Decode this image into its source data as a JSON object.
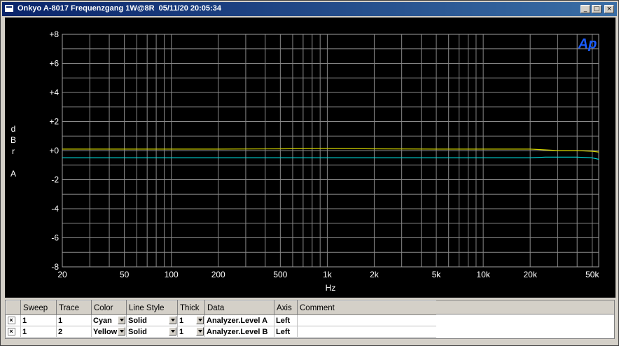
{
  "window": {
    "title": "Onkyo A-8017 Frequenzgang 1W@8R  05/11/20 20:05:34",
    "min_label": "_",
    "max_label": "□",
    "close_label": "×"
  },
  "chart_data": {
    "type": "line",
    "xlabel": "Hz",
    "ylabel": "dBr A",
    "x_scale": "log",
    "xlim": [
      20,
      55000
    ],
    "ylim": [
      -8,
      8
    ],
    "grid": true,
    "y_ticks": [
      "+8",
      "+6",
      "+4",
      "+2",
      "+0",
      "-2",
      "-4",
      "-6",
      "-8"
    ],
    "x_ticks": [
      "20",
      "50",
      "100",
      "200",
      "500",
      "1k",
      "2k",
      "5k",
      "10k",
      "20k",
      "50k"
    ],
    "logo": "Ap",
    "series": [
      {
        "color": "#00d8d8",
        "x": [
          20,
          50,
          100,
          200,
          500,
          1000,
          2000,
          5000,
          10000,
          20000,
          25000,
          30000,
          40000,
          50000,
          55000
        ],
        "y": [
          -0.5,
          -0.5,
          -0.5,
          -0.5,
          -0.5,
          -0.5,
          -0.5,
          -0.5,
          -0.5,
          -0.5,
          -0.45,
          -0.45,
          -0.45,
          -0.5,
          -0.6
        ]
      },
      {
        "color": "#d8d800",
        "x": [
          20,
          50,
          100,
          200,
          500,
          1000,
          2000,
          5000,
          10000,
          20000,
          25000,
          30000,
          40000,
          50000,
          55000
        ],
        "y": [
          0.1,
          0.1,
          0.1,
          0.1,
          0.12,
          0.15,
          0.12,
          0.1,
          0.1,
          0.1,
          0.05,
          0.0,
          0.0,
          -0.05,
          -0.1
        ]
      }
    ]
  },
  "table": {
    "headers": [
      "",
      "Sweep",
      "Trace",
      "Color",
      "Line Style",
      "Thick",
      "Data",
      "Axis",
      "Comment"
    ],
    "rows": [
      {
        "checked": "×",
        "sweep": "1",
        "trace": "1",
        "color": "Cyan",
        "style": "Solid",
        "thick": "1",
        "data": "Analyzer.Level A",
        "axis": "Left",
        "comment": ""
      },
      {
        "checked": "×",
        "sweep": "1",
        "trace": "2",
        "color": "Yellow",
        "style": "Solid",
        "thick": "1",
        "data": "Analyzer.Level B",
        "axis": "Left",
        "comment": ""
      }
    ]
  }
}
